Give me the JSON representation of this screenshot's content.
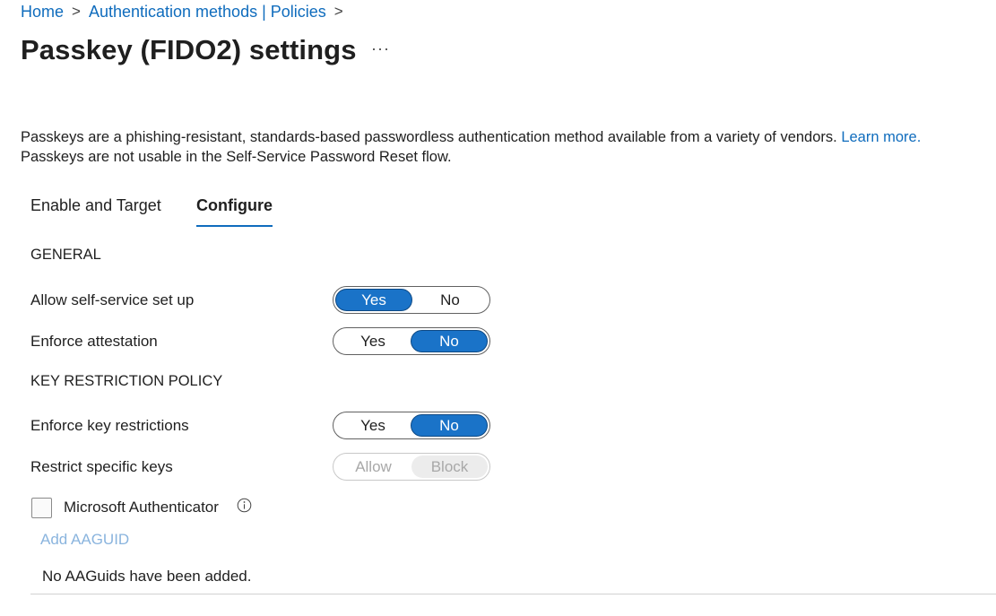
{
  "breadcrumb": {
    "home": "Home",
    "sep": ">",
    "parent": "Authentication methods | Policies"
  },
  "page": {
    "title": "Passkey (FIDO2) settings",
    "more": "···",
    "description_line1": "Passkeys are a phishing-resistant, standards-based passwordless authentication method available from a variety of vendors.",
    "learn_more": "Learn more.",
    "description_line2": "Passkeys are not usable in the Self-Service Password Reset flow."
  },
  "tabs": [
    {
      "label": "Enable and Target",
      "active": false
    },
    {
      "label": "Configure",
      "active": true
    }
  ],
  "general": {
    "heading": "GENERAL",
    "self_service": {
      "label": "Allow self-service set up",
      "yes": "Yes",
      "no": "No",
      "value": "Yes"
    },
    "attestation": {
      "label": "Enforce attestation",
      "yes": "Yes",
      "no": "No",
      "value": "No"
    }
  },
  "key_restriction": {
    "heading": "KEY RESTRICTION POLICY",
    "enforce": {
      "label": "Enforce key restrictions",
      "yes": "Yes",
      "no": "No",
      "value": "No"
    },
    "restrict": {
      "label": "Restrict specific keys",
      "allow": "Allow",
      "block": "Block",
      "value": "Block",
      "disabled": true
    },
    "authenticator": {
      "label": "Microsoft Authenticator",
      "checked": false
    },
    "add_aaguid": "Add AAGUID",
    "empty_message": "No AAGuids have been added."
  },
  "colors": {
    "accent": "#0f6cbd",
    "toggle_selected": "#1a73c8"
  }
}
